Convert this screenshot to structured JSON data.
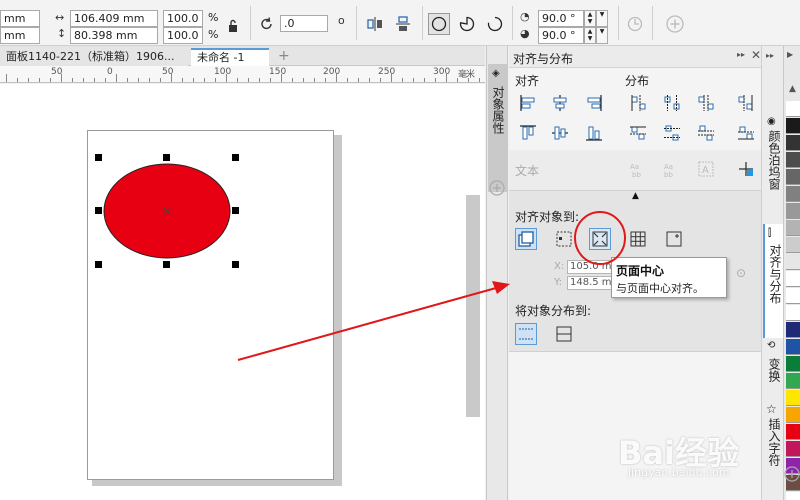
{
  "propbar": {
    "w_unit": "mm",
    "h_unit": "mm",
    "width_value": "106.409 mm",
    "height_value": "80.398 mm",
    "scale_x": "100.0",
    "scale_y": "100.0",
    "pct": "%",
    "rotation": ".0",
    "degree": "o",
    "angle1": "90.0 °",
    "angle2": "90.0 °"
  },
  "tabs": {
    "tab1": "面板1140-221（标准箱）1906...",
    "tab2": "未命名 -1",
    "add": "+"
  },
  "ruler": {
    "labels": [
      "50",
      "0",
      "50",
      "100",
      "150",
      "200",
      "250",
      "300"
    ],
    "unit": "毫米"
  },
  "left_dock": {
    "tab_label": "对象属性"
  },
  "panel": {
    "title": "对齐与分布",
    "align_label": "对齐",
    "distribute_label": "分布",
    "text_label": "文本",
    "align_to_label": "对齐对象到:",
    "x_value": "105.0 m",
    "y_value": "148.5 m",
    "x_label": "X:",
    "y_label": "Y:",
    "distribute_to_label": "将对象分布到:"
  },
  "tooltip": {
    "title": "页面中心",
    "desc": "与页面中心对齐。"
  },
  "right_dock": {
    "tab1": "颜色泊坞窗",
    "tab2": "对齐与分布",
    "tab3": "变换",
    "tab4": "插入字符"
  },
  "palette": {
    "colors": [
      "#ffffff",
      "#1a1a1a",
      "#333333",
      "#4d4d4d",
      "#666666",
      "#808080",
      "#999999",
      "#b3b3b3",
      "#cccccc",
      "#e6e6e6",
      "#ffffff",
      "#ffffff",
      "#ffffff",
      "#1e2a78",
      "#1f53a6",
      "#0b7d3b",
      "#2fa84f",
      "#ffe600",
      "#f7a600",
      "#e60012",
      "#c2185b",
      "#8e24aa",
      "#6d4c41",
      "#ffffff",
      "#ffffff"
    ]
  },
  "watermark": {
    "brand": "Bai经验",
    "url": "jingyan.baidu.com"
  },
  "colors": {
    "ellipse": "#e60012",
    "annotation": "#e0181a",
    "accent": "#5b9bd5"
  }
}
